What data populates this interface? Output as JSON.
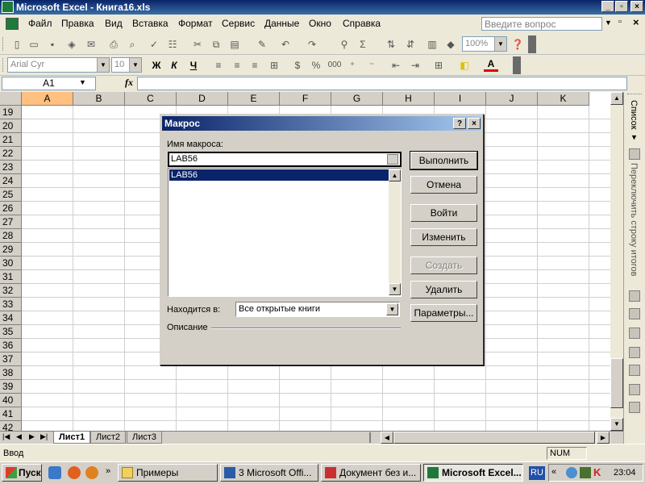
{
  "window": {
    "title": "Microsoft Excel - Книга16.xls",
    "minimize": "_",
    "restore": "▫",
    "close": "×"
  },
  "menu": {
    "items": [
      "Файл",
      "Правка",
      "Вид",
      "Вставка",
      "Формат",
      "Сервис",
      "Данные",
      "Окно",
      "Справка"
    ],
    "question_placeholder": "Введите вопрос",
    "doc_close": "×"
  },
  "toolbar": {
    "zoom": "100%",
    "font": "Arial Cyr",
    "size": "10",
    "bold": "Ж",
    "italic": "К",
    "underline": "Ч",
    "currency_icon": "$",
    "percent_icon": "%",
    "thousands_icon": "000",
    "font_color": "A"
  },
  "formula": {
    "name_box": "A1",
    "fx": "fx",
    "value": ""
  },
  "grid": {
    "columns": [
      "A",
      "B",
      "C",
      "D",
      "E",
      "F",
      "G",
      "H",
      "I",
      "J",
      "K"
    ],
    "rows": [
      "19",
      "20",
      "21",
      "22",
      "23",
      "24",
      "25",
      "26",
      "27",
      "28",
      "29",
      "30",
      "31",
      "32",
      "33",
      "34",
      "35",
      "36",
      "37",
      "38",
      "39",
      "40",
      "41",
      "42"
    ]
  },
  "sheets": {
    "tabs": [
      "Лист1",
      "Лист2",
      "Лист3"
    ],
    "active": "Лист1"
  },
  "status": {
    "mode": "Ввод",
    "num": "NUM"
  },
  "taskpane": {
    "list_label": "Список ▾",
    "toggle_total_label": "Переключить строку итогов"
  },
  "taskbar": {
    "start": "Пуск",
    "buttons": [
      "Примеры",
      "3 Microsoft Offi...",
      "Документ без и...",
      "Microsoft Excel..."
    ],
    "lang": "RU",
    "clock": "23:04",
    "quick_launch_separator": "»",
    "tray_arrows": "«"
  },
  "dialog": {
    "title": "Макрос",
    "help": "?",
    "close": "×",
    "name_label": "Имя макроса:",
    "name_value": "LAB56",
    "macros": [
      "LAB56"
    ],
    "location_label": "Находится в:",
    "location_value": "Все открытые книги",
    "description_label": "Описание",
    "buttons": {
      "run": "Выполнить",
      "cancel": "Отмена",
      "step_into": "Войти",
      "edit": "Изменить",
      "create": "Создать",
      "delete": "Удалить",
      "options": "Параметры..."
    }
  }
}
